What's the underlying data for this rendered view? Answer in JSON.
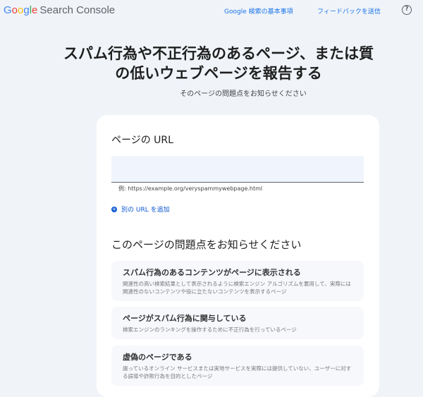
{
  "header": {
    "logo_google": "Google",
    "logo_product": "Search Console",
    "link_basics": "Google 検索の基本事項",
    "link_feedback": "フィードバックを送信",
    "help_icon": "?"
  },
  "page": {
    "title": "スパム行為や不正行為のあるページ、または質の低いウェブページを報告する",
    "subtitle": "そのページの問題点をお知らせください"
  },
  "form": {
    "url_label": "ページの URL",
    "url_value": "",
    "url_hint": "例: https://example.org/veryspammywebpage.html",
    "add_url": "別の URL を追加",
    "issues_heading": "このページの問題点をお知らせください",
    "options": [
      {
        "title": "スパム行為のあるコンテンツがページに表示される",
        "desc": "関連性の高い検索結果として表示されるように検索エンジン アルゴリズムを悪用して、実際には関連性のないコンテンツや役に立たないコンテンツを表示するページ"
      },
      {
        "title": "ページがスパム行為に関与している",
        "desc": "検索エンジンのランキングを操作するために不正行為を行っているページ"
      },
      {
        "title": "虚偽のページである",
        "desc": "謳っているオンライン サービスまたは実地サービスを実際には提供していない、ユーザーに対する誤導や詐欺行為を目的としたページ"
      }
    ]
  }
}
